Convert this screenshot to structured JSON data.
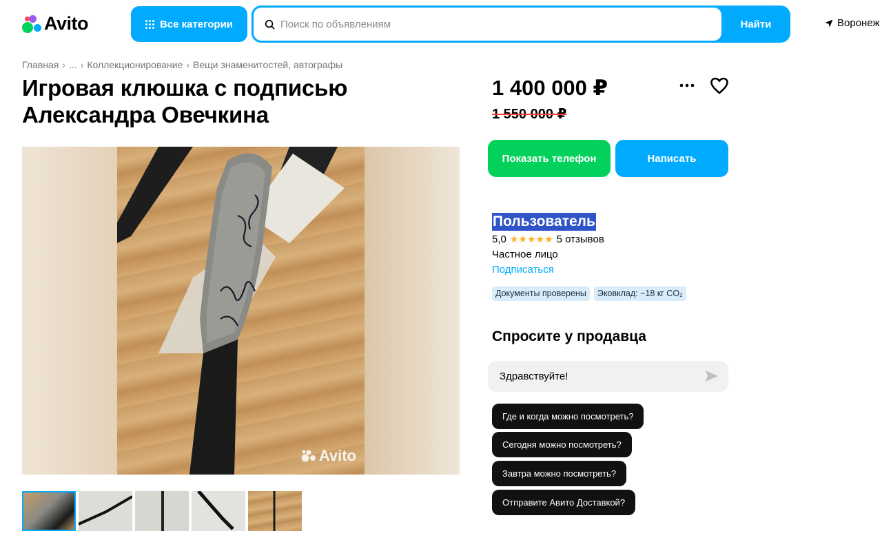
{
  "header": {
    "logo_text": "Avito",
    "categories_label": "Все категории",
    "search_placeholder": "Поиск по объявлениям",
    "search_button": "Найти",
    "location": "Воронеж",
    "brand_colors": {
      "blue": "#00aaff",
      "green": "#02d15c",
      "purple": "#965eeb",
      "red": "#ff4053"
    }
  },
  "breadcrumb": [
    "Главная",
    "...",
    "Коллекционирование",
    "Вещи знаменитостей, автографы"
  ],
  "listing": {
    "title": "Игровая клюшка с подписью Александра Овечкина",
    "price": "1 400 000 ₽",
    "old_price": "1 550 000 ₽",
    "photo_watermark": "Avito",
    "thumbnails_count": 5,
    "active_thumbnail": 1
  },
  "actions": {
    "show_phone": "Показать телефон",
    "write": "Написать",
    "more_icon": "more-horizontal-icon",
    "favorite_icon": "heart-icon"
  },
  "seller": {
    "name": "Пользователь",
    "rating": "5,0",
    "stars": "★★★★★",
    "reviews": "5 отзывов",
    "type": "Частное лицо",
    "subscribe": "Подписаться",
    "badges": [
      "Документы проверены",
      "Эковклад: −18 кг CO₂"
    ]
  },
  "ask": {
    "title": "Спросите у продавца",
    "input_value": "Здравствуйте!",
    "quick_questions": [
      "Где и когда можно посмотреть?",
      "Сегодня можно посмотреть?",
      "Завтра можно посмотреть?",
      "Отправите Авито Доставкой?"
    ]
  }
}
